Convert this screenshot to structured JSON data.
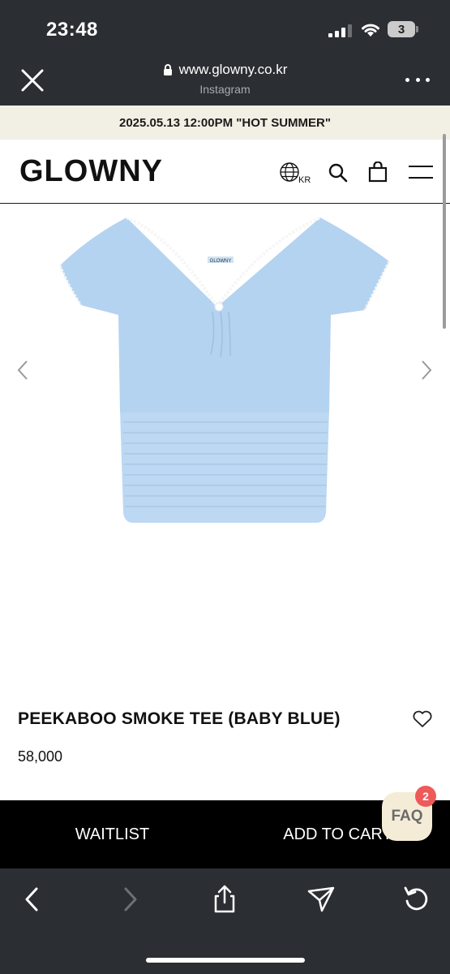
{
  "status_bar": {
    "time": "23:48",
    "battery_level": "3"
  },
  "browser": {
    "url": "www.glowny.co.kr",
    "subtitle": "Instagram"
  },
  "announcement": {
    "text": "2025.05.13 12:00PM \"HOT SUMMER\""
  },
  "header": {
    "logo": "GLOWNY",
    "region_label": "KR"
  },
  "product": {
    "label_tag": "GLOWNY",
    "name": "PEEKABOO SMOKE TEE (BABY BLUE)",
    "price": "58,000",
    "garment_color": "#b9d6f1"
  },
  "actions": {
    "waitlist_label": "WAITLIST",
    "add_to_cart_label": "ADD TO CART"
  },
  "faq": {
    "label": "FAQ",
    "badge_count": "2"
  },
  "colors": {
    "browser_chrome": "#2b2e33",
    "announcement_bg": "#f2efe4",
    "cta_bg": "#000000",
    "faq_bg": "#f4ecd7",
    "badge": "#ee5a5a"
  },
  "icons": [
    "close-icon",
    "lock-icon",
    "more-icon",
    "globe-icon",
    "search-icon",
    "bag-icon",
    "menu-icon",
    "chevron-left-icon",
    "chevron-right-icon",
    "heart-icon",
    "back-icon",
    "forward-icon",
    "share-icon",
    "send-icon",
    "refresh-icon"
  ]
}
